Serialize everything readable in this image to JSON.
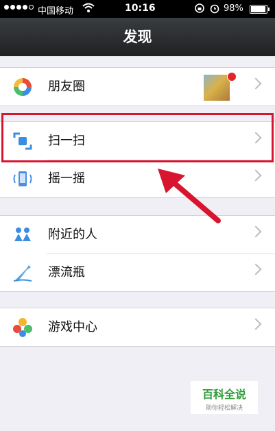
{
  "status_bar": {
    "carrier": "中国移动",
    "time": "10:16",
    "battery": "98%"
  },
  "nav": {
    "title": "发现"
  },
  "groups": [
    {
      "items": [
        {
          "label": "朋友圈",
          "icon": "moments-icon"
        }
      ]
    },
    {
      "items": [
        {
          "label": "扫一扫",
          "icon": "scan-icon"
        },
        {
          "label": "摇一摇",
          "icon": "shake-icon"
        }
      ]
    },
    {
      "items": [
        {
          "label": "附近的人",
          "icon": "nearby-people-icon"
        },
        {
          "label": "漂流瓶",
          "icon": "drift-bottle-icon"
        }
      ]
    },
    {
      "items": [
        {
          "label": "游戏中心",
          "icon": "game-center-icon"
        }
      ]
    }
  ],
  "watermark": {
    "title": "百科全说",
    "subtitle": "助你轻松解决"
  },
  "colors": {
    "highlight": "#d8152f",
    "arrow": "#d8152f"
  }
}
